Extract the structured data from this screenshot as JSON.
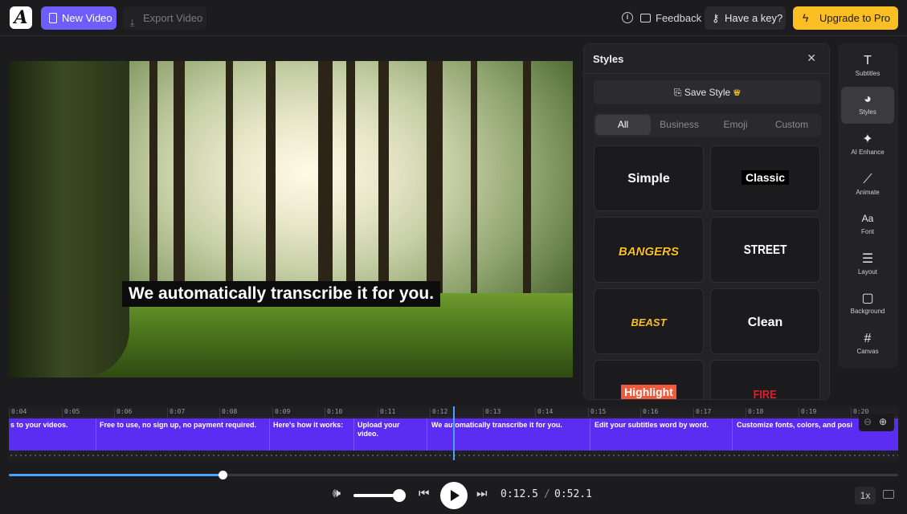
{
  "topbar": {
    "new_video": "New Video",
    "export_video": "Export Video",
    "feedback": "Feedback",
    "have_key": "Have a key?",
    "upgrade": "Upgrade to Pro",
    "accent": "#6d5efc",
    "upgrade_color": "#fbbf24"
  },
  "preview": {
    "caption": "We automatically transcribe it for you."
  },
  "styles_panel": {
    "title": "Styles",
    "save_style": "Save Style",
    "tabs": [
      "All",
      "Business",
      "Emoji",
      "Custom"
    ],
    "active_tab": "All",
    "cards": [
      "Simple",
      "Classic",
      "BANGERS",
      "STREET",
      "BEAST",
      "Clean",
      "Highlight",
      "FIRE"
    ]
  },
  "rail": {
    "items": [
      {
        "label": "Subtitles",
        "icon": "text-icon"
      },
      {
        "label": "Styles",
        "icon": "palette-icon"
      },
      {
        "label": "AI Enhance",
        "icon": "sparkle-icon"
      },
      {
        "label": "Animate",
        "icon": "magic-wand-icon"
      },
      {
        "label": "Font",
        "icon": "font-size-icon"
      },
      {
        "label": "Layout",
        "icon": "align-icon"
      },
      {
        "label": "Background",
        "icon": "square-icon"
      },
      {
        "label": "Canvas",
        "icon": "hash-icon"
      }
    ],
    "active": "Styles"
  },
  "timeline": {
    "ticks": [
      "0:04",
      "0:05",
      "0:06",
      "0:07",
      "0:08",
      "0:09",
      "0:10",
      "0:11",
      "0:12",
      "0:13",
      "0:14",
      "0:15",
      "0:16",
      "0:17",
      "0:18",
      "0:19",
      "0:20"
    ],
    "segments": [
      "s to your videos.",
      "Free to use, no sign up, no payment required.",
      "Here's how it works:",
      "Upload your video.",
      "We automatically transcribe it for you.",
      "Edit your subtitles word by word.",
      "Customize fonts, colors, and posi"
    ]
  },
  "player": {
    "progress_fraction": 0.24,
    "volume_fraction": 0.95,
    "current_time": "0:12.5",
    "separator": "/",
    "total_time": "0:52.1",
    "speed": "1x"
  }
}
